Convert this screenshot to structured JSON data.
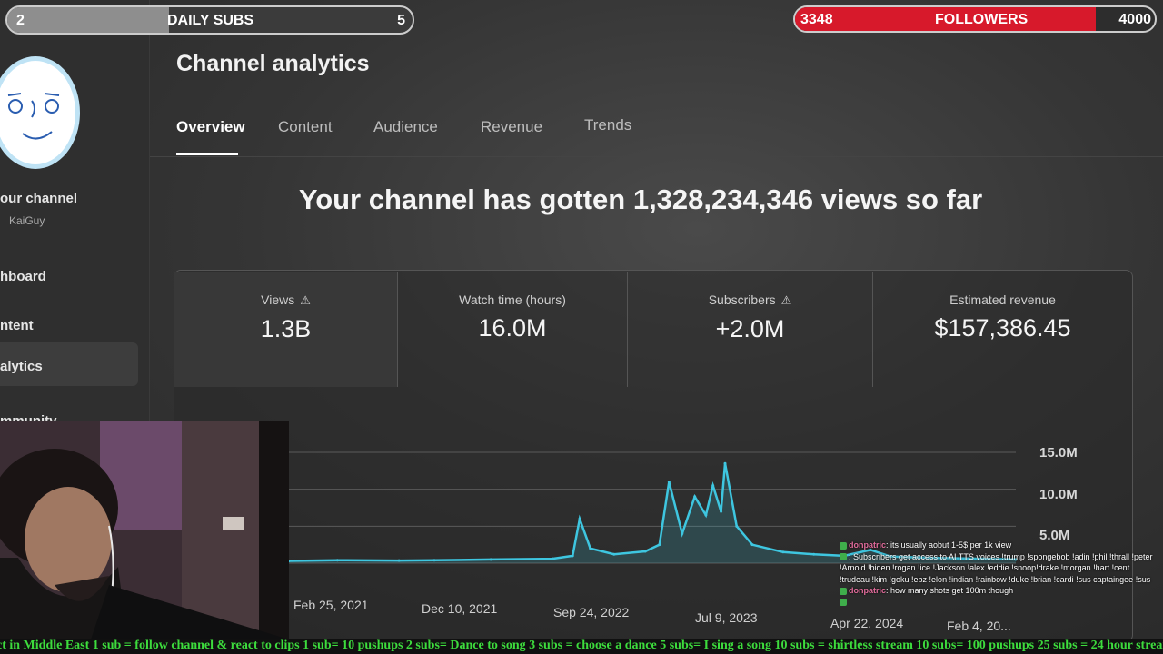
{
  "sidebar": {
    "your_channel": "our channel",
    "channel_name": "KaiGuy",
    "items": [
      {
        "label": "hboard"
      },
      {
        "label": "ntent"
      },
      {
        "label": "alytics"
      },
      {
        "label": "mmunity"
      }
    ]
  },
  "page": {
    "title": "Channel analytics",
    "headline": "Your channel has gotten 1,328,234,346 views so far"
  },
  "tabs": [
    {
      "label": "Overview",
      "active": true
    },
    {
      "label": "Content"
    },
    {
      "label": "Audience"
    },
    {
      "label": "Revenue"
    },
    {
      "label": "Trends"
    }
  ],
  "metrics": [
    {
      "label": "Views",
      "value": "1.3B",
      "warning": true
    },
    {
      "label": "Watch time (hours)",
      "value": "16.0M"
    },
    {
      "label": "Subscribers",
      "value": "+2.0M",
      "warning": true
    },
    {
      "label": "Estimated revenue",
      "value": "$157,386.45"
    }
  ],
  "chart_data": {
    "type": "line",
    "y_ticks": [
      "15.0M",
      "10.0M",
      "5.0M"
    ],
    "x_ticks": [
      "Feb 25, 2021",
      "Dec 10, 2021",
      "Sep 24, 2022",
      "Jul 9, 2023",
      "Apr 22, 2024",
      "Feb 4, 20..."
    ],
    "ylim": [
      0,
      15000000
    ],
    "series_color": "#3ec6e0",
    "x": [
      "2021-02-25",
      "2021-06-01",
      "2021-10-01",
      "2021-12-10",
      "2022-04-01",
      "2022-08-01",
      "2022-09-10",
      "2022-09-24",
      "2022-10-15",
      "2022-12-01",
      "2023-02-01",
      "2023-03-01",
      "2023-03-20",
      "2023-04-15",
      "2023-05-10",
      "2023-06-01",
      "2023-06-15",
      "2023-07-01",
      "2023-07-09",
      "2023-08-01",
      "2023-09-01",
      "2023-11-01",
      "2024-01-01",
      "2024-03-01",
      "2024-04-22",
      "2024-06-01",
      "2024-09-01",
      "2024-12-01",
      "2025-02-04"
    ],
    "values": [
      300000,
      400000,
      350000,
      400000,
      500000,
      600000,
      1000000,
      6000000,
      2000000,
      1200000,
      1600000,
      2500000,
      11000000,
      4000000,
      9000000,
      6500000,
      10500000,
      7000000,
      13500000,
      5000000,
      2500000,
      1500000,
      1200000,
      1000000,
      1800000,
      900000,
      700000,
      600000,
      500000
    ]
  },
  "overlay": {
    "daily_subs": {
      "label": "DAILY SUBS",
      "current": "2",
      "goal": "5",
      "fraction": 0.4
    },
    "followers": {
      "label": "FOLLOWERS",
      "current": "3348",
      "goal": "4000",
      "fraction": 0.837
    }
  },
  "chat": [
    {
      "user": "donpatric",
      "message": ": its usually aobut 1-5$ per 1k view"
    },
    {
      "user": "",
      "message": ": Subscribers get access to AI TTS voices !trump !spongebob !adin !phil !thrall !peter !Arnold !biden !rogan !ice !Jackson !alex !eddie !snoop!drake !morgan !hart !cent !trudeau !kim !goku !ebz !elon !indian !rainbow !duke !brian !cardi !sus captaingee !sus"
    },
    {
      "user": "donpatric",
      "message": ": how many shots get 100m though"
    },
    {
      "user": "",
      "message": ""
    }
  ],
  "ticker": "ct in Middle East 1 sub = follow channel & react to clips  1 sub= 10 pushups  2 subs= Dance to song  3 subs = choose a dance  5 subs= I sing a song  10 subs = shirtless stream 10 subs= 100 pushups  25 subs = 24 hour stream"
}
